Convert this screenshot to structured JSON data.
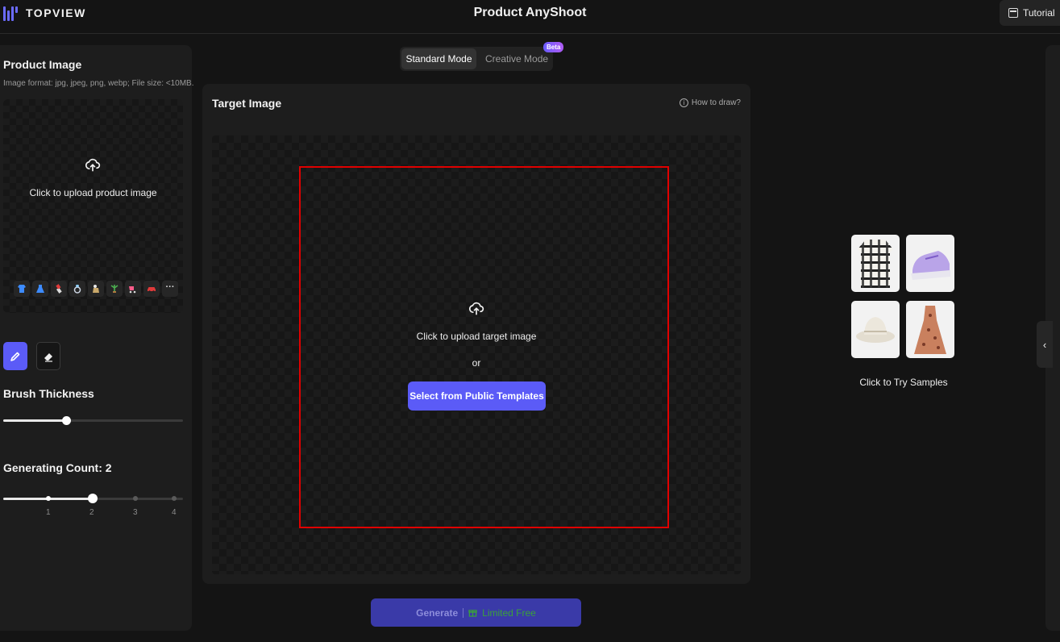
{
  "header": {
    "logo_text": "TOPVIEW",
    "app_title": "Product AnyShoot",
    "tutorial_label": "Tutorial"
  },
  "left": {
    "product_title": "Product Image",
    "product_hint": "Image format: jpg, jpeg, png, webp; File size: <10MB.",
    "upload_text": "Click to upload product image",
    "categories": [
      "shirt-icon",
      "dress-icon",
      "lipstick-icon",
      "ring-icon",
      "figurine-icon",
      "plant-icon",
      "stroller-icon",
      "car-icon",
      "more-icon"
    ],
    "brush_title": "Brush Thickness",
    "brush_value": 0.35,
    "count_title": "Generating Count: 2",
    "count_value": 2,
    "count_ticks": [
      "1",
      "2",
      "3",
      "4"
    ]
  },
  "modes": {
    "standard": "Standard Mode",
    "creative": "Creative Mode",
    "beta": "Beta"
  },
  "target": {
    "title": "Target Image",
    "how_to": "How to draw?",
    "upload_text": "Click to upload target image",
    "or_text": "or",
    "select_button": "Select from Public Templates"
  },
  "generate": {
    "label": "Generate",
    "free_label": "Limited Free"
  },
  "samples": {
    "caption": "Click to Try Samples",
    "items": [
      "plaid-shirt-sample",
      "sneaker-sample",
      "bucket-hat-sample",
      "floral-dress-sample"
    ]
  },
  "colors": {
    "accent": "#5b5bf7",
    "highlight_box": "#e00000",
    "free_green": "#3aa13a"
  }
}
